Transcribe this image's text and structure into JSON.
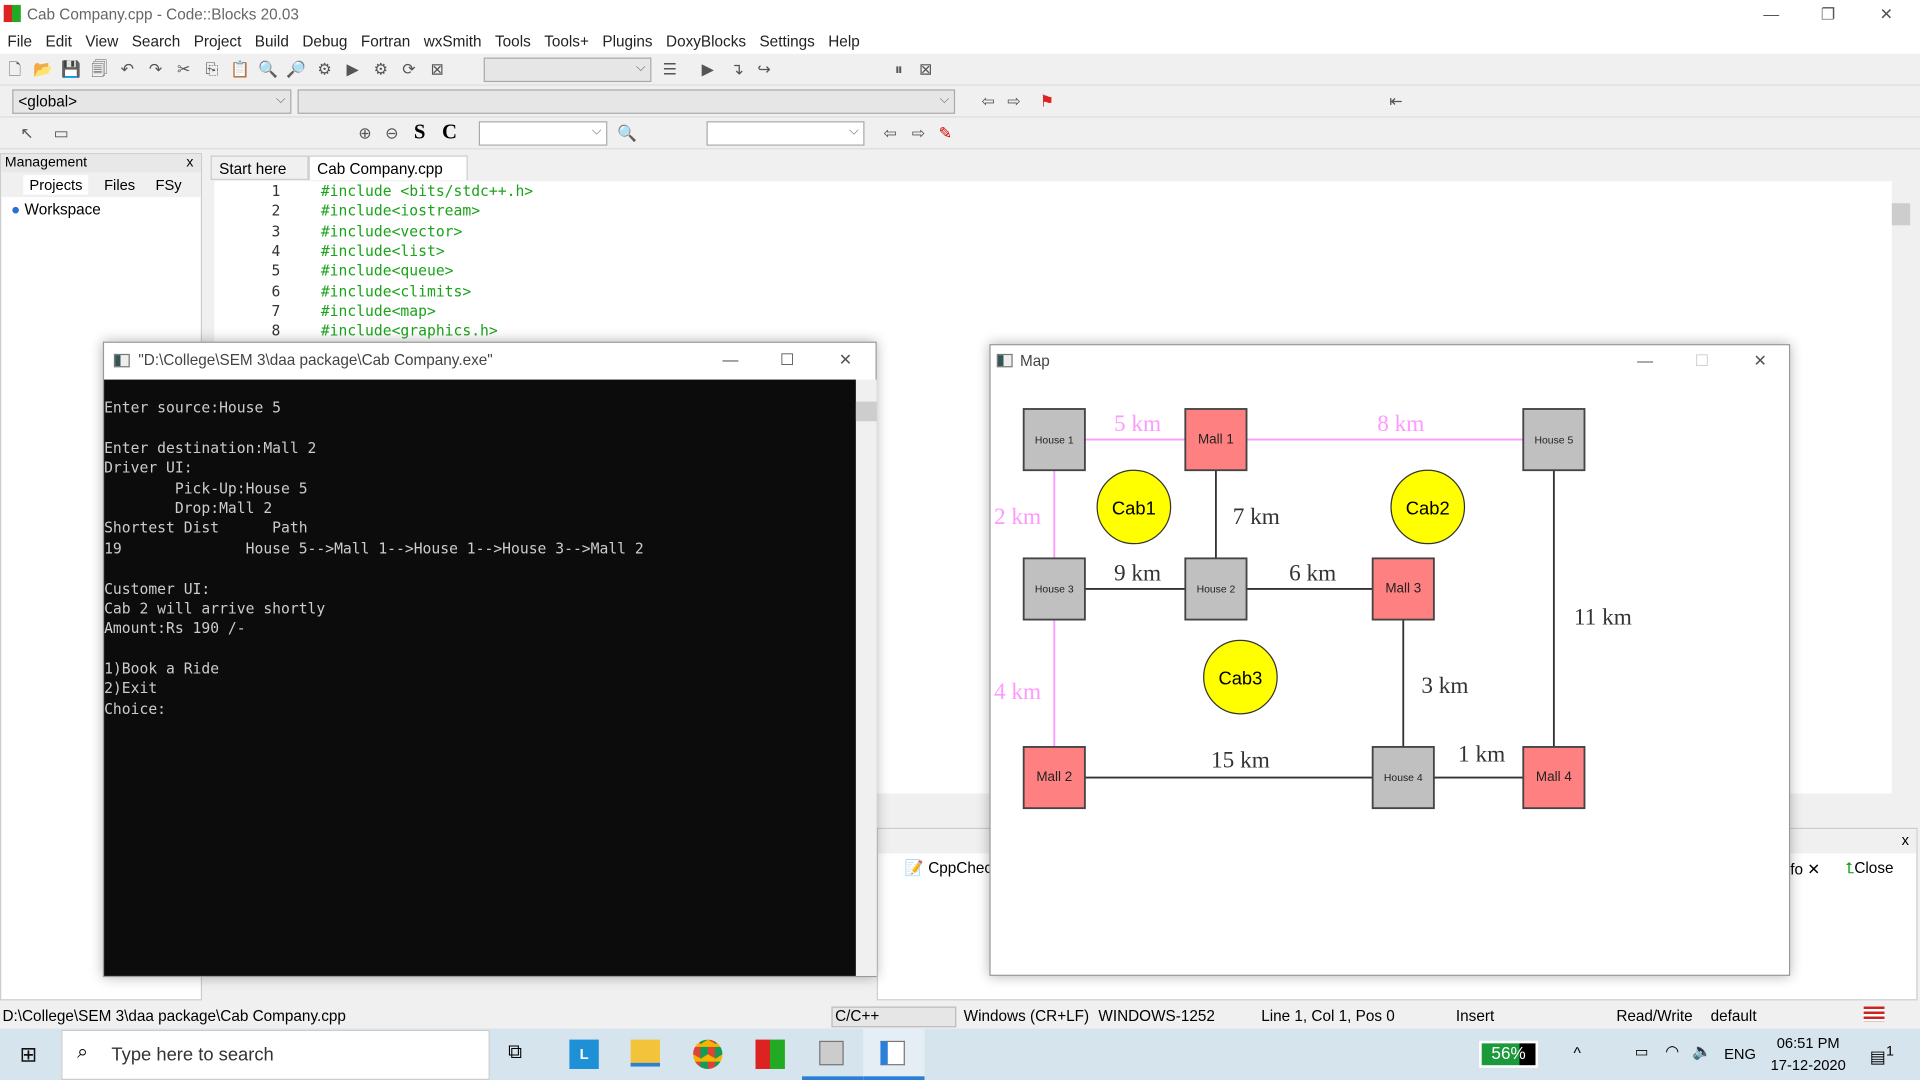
{
  "app": {
    "title": "Cab Company.cpp - Code::Blocks 20.03"
  },
  "menu": [
    "File",
    "Edit",
    "View",
    "Search",
    "Project",
    "Build",
    "Debug",
    "Fortran",
    "wxSmith",
    "Tools",
    "Tools+",
    "Plugins",
    "DoxyBlocks",
    "Settings",
    "Help"
  ],
  "toolbar": {
    "scope_combo": "<global>",
    "s_label": "S",
    "c_label": "C"
  },
  "management": {
    "title": "Management",
    "tabs": [
      "Projects",
      "Files",
      "FSy"
    ],
    "tree": [
      "Workspace"
    ]
  },
  "editor": {
    "tabs": [
      "Start here",
      "Cab Company.cpp"
    ],
    "lines": [
      "#include <bits/stdc++.h>",
      "#include<iostream>",
      "#include<vector>",
      "#include<list>",
      "#include<queue>",
      "#include<climits>",
      "#include<map>",
      "#include<graphics.h>"
    ]
  },
  "console": {
    "title": "\"D:\\College\\SEM 3\\daa package\\Cab Company.exe\"",
    "lines": [
      "Enter source:House 5",
      "",
      "Enter destination:Mall 2",
      "Driver UI:",
      "        Pick-Up:House 5",
      "        Drop:Mall 2",
      "Shortest Dist      Path",
      "19              House 5-->Mall 1-->House 1-->House 3-->Mall 2",
      "",
      "Customer UI:",
      "Cab 2 will arrive shortly",
      "Amount:Rs 190 /-",
      "",
      "1)Book a Ride",
      "2)Exit",
      "Choice:"
    ]
  },
  "logs": {
    "tabs": [
      "CppCheck",
      "fo",
      "Close"
    ]
  },
  "map": {
    "title": "Map",
    "colors": {
      "house": "#c0c0c0",
      "mall": "#ff8080",
      "cab": "#ffff00",
      "path": "#ff99ff",
      "edge": "#333333"
    },
    "nodes": [
      {
        "id": "h1",
        "label": "House 1",
        "type": "house"
      },
      {
        "id": "m1",
        "label": "Mall 1",
        "type": "mall"
      },
      {
        "id": "h5",
        "label": "House 5",
        "type": "house"
      },
      {
        "id": "h3",
        "label": "House 3",
        "type": "house"
      },
      {
        "id": "h2",
        "label": "House 2",
        "type": "house"
      },
      {
        "id": "m3",
        "label": "Mall 3",
        "type": "mall"
      },
      {
        "id": "m2",
        "label": "Mall 2",
        "type": "mall"
      },
      {
        "id": "h4",
        "label": "House 4",
        "type": "house"
      },
      {
        "id": "m4",
        "label": "Mall 4",
        "type": "mall"
      }
    ],
    "cabs": [
      "Cab1",
      "Cab2",
      "Cab3"
    ],
    "edges": [
      {
        "from": "h1",
        "to": "m1",
        "label": "5 km",
        "on_path": true
      },
      {
        "from": "m1",
        "to": "h5",
        "label": "8 km",
        "on_path": true
      },
      {
        "from": "h1",
        "to": "h3",
        "label": "2 km",
        "on_path": true
      },
      {
        "from": "m1",
        "to": "h2",
        "label": "7 km",
        "on_path": false
      },
      {
        "from": "h3",
        "to": "h2",
        "label": "9 km",
        "on_path": false
      },
      {
        "from": "h2",
        "to": "m3",
        "label": "6 km",
        "on_path": false
      },
      {
        "from": "h5",
        "to": "m4",
        "label": "11 km",
        "on_path": false
      },
      {
        "from": "h3",
        "to": "m2",
        "label": "4 km",
        "on_path": true
      },
      {
        "from": "m3",
        "to": "h4",
        "label": "3 km",
        "on_path": false
      },
      {
        "from": "m2",
        "to": "h4",
        "label": "15 km",
        "on_path": false
      },
      {
        "from": "h4",
        "to": "m4",
        "label": "1 km",
        "on_path": false
      }
    ]
  },
  "status": {
    "path": "D:\\College\\SEM 3\\daa package\\Cab Company.cpp",
    "lang": "C/C++",
    "eol": "Windows (CR+LF)",
    "enc": "WINDOWS-1252",
    "pos": "Line 1, Col 1, Pos 0",
    "mode": "Insert",
    "rw": "Read/Write",
    "profile": "default"
  },
  "taskbar": {
    "search_placeholder": "Type here to search",
    "battery": "56%",
    "lang": "ENG",
    "time": "06:51 PM",
    "date": "17-12-2020",
    "notifications": "1"
  }
}
